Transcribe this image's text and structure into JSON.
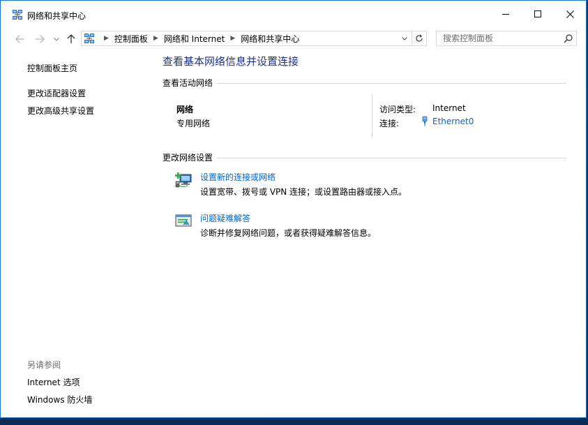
{
  "window": {
    "title": "网络和共享中心"
  },
  "address_bar": {
    "breadcrumbs": [
      "控制面板",
      "网络和 Internet",
      "网络和共享中心"
    ]
  },
  "search": {
    "placeholder": "搜索控制面板"
  },
  "left_pane": {
    "home_link": "控制面板主页",
    "links": [
      "更改适配器设置",
      "更改高级共享设置"
    ],
    "see_also_label": "另请参阅",
    "see_also_links": [
      "Internet 选项",
      "Windows 防火墙"
    ]
  },
  "main": {
    "title": "查看基本网络信息并设置连接",
    "active_networks_header": "查看活动网络",
    "network": {
      "name": "网络",
      "category": "专用网络",
      "access_type_label": "访问类型:",
      "access_type_value": "Internet",
      "connections_label": "连接:",
      "connection_name": "Ethernet0"
    },
    "change_settings_header": "更改网络设置",
    "tasks": [
      {
        "title": "设置新的连接或网络",
        "description": "设置宽带、拨号或 VPN 连接；或设置路由器或接入点。"
      },
      {
        "title": "问题疑难解答",
        "description": "诊断并修复网络问题，或者获得疑难解答信息。"
      }
    ]
  },
  "colors": {
    "link": "#0066cc",
    "title": "#1e3287",
    "window_border": "#1c70c8",
    "desktop": "#0b3a6e"
  },
  "icons": {
    "app": "network-computers-icon",
    "back": "arrow-left-icon",
    "forward": "arrow-right-icon",
    "recent": "chevron-down-icon",
    "up": "arrow-up-icon",
    "refresh": "refresh-icon",
    "search": "search-icon",
    "ethernet": "ethernet-plug-icon",
    "new_connection": "new-connection-icon",
    "troubleshoot": "troubleshoot-icon"
  }
}
